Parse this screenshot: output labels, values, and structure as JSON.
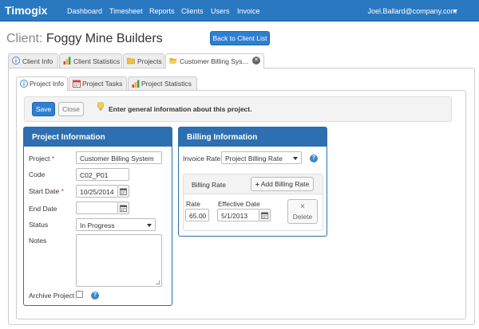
{
  "app": {
    "brand": "Timogix"
  },
  "nav": {
    "items": [
      "Dashboard",
      "Timesheet",
      "Reports",
      "Clients",
      "Users",
      "Invoice"
    ],
    "user": "Joel.Ballard@company.com"
  },
  "page": {
    "title_prefix": "Client:",
    "client_name": "Foggy Mine Builders",
    "back_button": "Back to Client List"
  },
  "outer_tabs": [
    {
      "label": "Client Info"
    },
    {
      "label": "Client Statistics"
    },
    {
      "label": "Projects"
    },
    {
      "label": "Customer Billing Sys..."
    }
  ],
  "inner_tabs": [
    {
      "label": "Project Info"
    },
    {
      "label": "Project Tasks"
    },
    {
      "label": "Project Statistics"
    }
  ],
  "actions": {
    "save": "Save",
    "close": "Close",
    "hint": "Enter general information about this project."
  },
  "project_info": {
    "heading": "Project Information",
    "project_label": "Project",
    "project_value": "Customer Billing System",
    "code_label": "Code",
    "code_value": "C02_P01",
    "start_label": "Start Date",
    "start_value": "10/25/2014",
    "end_label": "End Date",
    "end_value": "",
    "status_label": "Status",
    "status_value": "In Progress",
    "notes_label": "Notes",
    "archive_label": "Archive Project",
    "required_mark": "*"
  },
  "billing_info": {
    "heading": "Billing Information",
    "invoice_rate_label": "Invoice Rate",
    "invoice_rate_value": "Project Billing Rate",
    "billing_rate_heading": "Billing Rate",
    "add_button": "Add Billing Rate",
    "rate_label": "Rate",
    "rate_value": "65.00",
    "effective_label": "Effective Date",
    "effective_value": "5/1/2013",
    "delete_glyph": "×",
    "delete_button": "Delete"
  },
  "symbols": {
    "help": "?",
    "plus": "+",
    "close": "✕"
  },
  "colors": {
    "primary": "#2a78c0",
    "panel_header": "#2d6fb0",
    "required": "#d33333"
  }
}
